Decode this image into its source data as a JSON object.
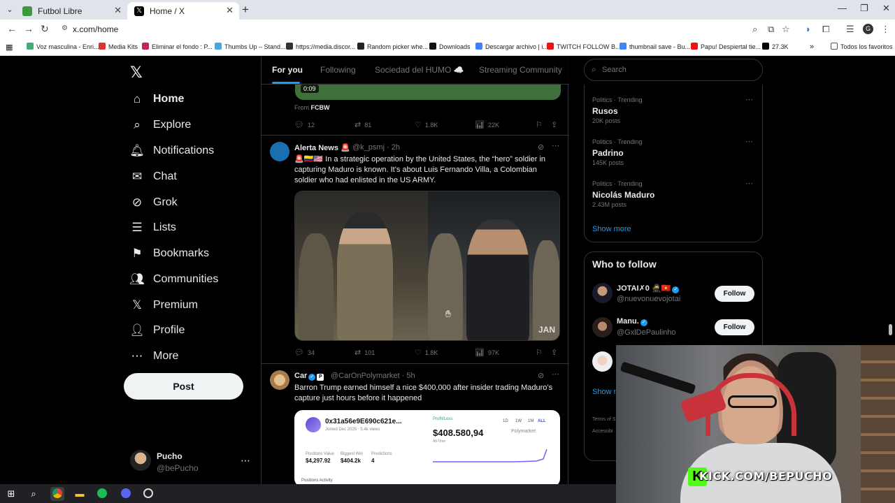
{
  "browser": {
    "tabs": [
      {
        "title": "Futbol Libre",
        "active": false
      },
      {
        "title": "Home / X",
        "active": true
      }
    ],
    "url": "x.com/home",
    "bookmarks": [
      "Voz masculina - Enri...",
      "Media Kits",
      "Eliminar el fondo : P...",
      "Thumbs Up – Stand...",
      "https://media.discor...",
      "Random picker whe...",
      "Downloads",
      "Descargar archivo | i...",
      "TWITCH FOLLOW B...",
      "thumbnail save - Bu...",
      "Papu! Despiertal tie...",
      "27.3K",
      "Todos los favoritos"
    ]
  },
  "sidebar": {
    "items": [
      {
        "label": "Home",
        "icon": "home-icon"
      },
      {
        "label": "Explore",
        "icon": "search-icon"
      },
      {
        "label": "Notifications",
        "icon": "bell-icon"
      },
      {
        "label": "Chat",
        "icon": "mail-icon"
      },
      {
        "label": "Grok",
        "icon": "grok-icon"
      },
      {
        "label": "Lists",
        "icon": "list-icon"
      },
      {
        "label": "Bookmarks",
        "icon": "bookmark-icon"
      },
      {
        "label": "Communities",
        "icon": "communities-icon"
      },
      {
        "label": "Premium",
        "icon": "x-logo-icon"
      },
      {
        "label": "Profile",
        "icon": "person-icon"
      },
      {
        "label": "More",
        "icon": "more-icon"
      }
    ],
    "post_label": "Post",
    "account": {
      "name": "Pucho",
      "handle": "@bePucho"
    }
  },
  "feed": {
    "tabs": [
      "For you",
      "Following",
      "Sociedad del HUMO ☁️",
      "Streaming Community"
    ],
    "top_post": {
      "video_time": "0:09",
      "from_prefix": "From",
      "from_source": "FCBW",
      "replies": "12",
      "reposts": "81",
      "likes": "1.8K",
      "views": "22K"
    },
    "posts": [
      {
        "name": "Alerta News 🚨",
        "handle": "@k_psmj · 2h",
        "text": "🚨🇨🇴🇺🇸 In a strategic operation by the United States, the “hero” soldier in capturing Maduro is known. It’s about Luis Fernando Villa, a Colombian soldier who had enlisted in the US ARMY.",
        "image_watermark": "JAN",
        "replies": "34",
        "reposts": "101",
        "likes": "1.8K",
        "views": "97K"
      },
      {
        "name": "Car",
        "handle": "@CarOnPolymarket · 5h",
        "text": "Barron Trump earned himself a nice $400,000 after insider trading Maduro’s capture just hours before it happened",
        "card": {
          "address": "0x31a56e9E690c621e...",
          "joined": "Joined Dec 2025 · 5.4k views",
          "stats": [
            {
              "label": "Positions Value",
              "value": "$4,297.92"
            },
            {
              "label": "Biggest Win",
              "value": "$404.2k"
            },
            {
              "label": "Predictions",
              "value": "4"
            }
          ],
          "profit_label": "Profit/Loss",
          "profit_value": "$408.580,94",
          "alltime": "All-Time",
          "brand": "Polymarket",
          "ranges": [
            "1D",
            "1W",
            "1M",
            "ALL"
          ],
          "tabs": "Positions   Activity"
        }
      }
    ]
  },
  "right": {
    "search_placeholder": "Search",
    "trends": [
      {
        "category": "Politics · Trending",
        "name": "Rusos",
        "count": "20K posts"
      },
      {
        "category": "Politics · Trending",
        "name": "Padrino",
        "count": "145K posts"
      },
      {
        "category": "Politics · Trending",
        "name": "Nicolás Maduro",
        "count": "2.43M posts"
      }
    ],
    "show_more": "Show more",
    "who_to_follow": "Who to follow",
    "follows": [
      {
        "name": "JOTAI✗0 🥷🇻🇳",
        "handle": "@nuevonuevojotai",
        "follow": "Follow"
      },
      {
        "name": "Manu.",
        "handle": "@GxlDePaulinho",
        "follow": "Follow"
      }
    ],
    "show_more_2": "Show m",
    "footer": [
      "Terms of S",
      "Accessibi"
    ]
  },
  "stream": {
    "overlay_text": "KICK.COM/BEPUCHO",
    "brand_color": "#53fc18"
  },
  "colors": {
    "accent": "#1d9bf0",
    "bg": "#000000",
    "border": "#2f3336",
    "muted": "#71767b"
  }
}
